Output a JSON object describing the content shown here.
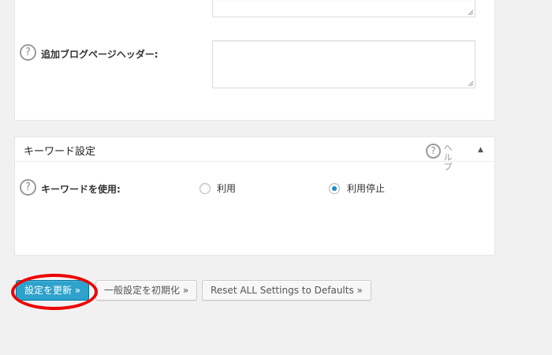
{
  "fields": {
    "extra_blog_header_label": "追加ブログページヘッダー:",
    "extra_blog_header_value": "",
    "keywords_label": "キーワードを使用:"
  },
  "keywords_box": {
    "title": "キーワード設定",
    "help_label": "ヘルプ",
    "toggle_glyph": "▲",
    "radio_options": [
      {
        "label": "利用",
        "checked": false
      },
      {
        "label": "利用停止",
        "checked": true
      }
    ]
  },
  "help_glyph": "?",
  "buttons": {
    "update": "設定を更新 »",
    "reset_general": "一般設定を初期化 »",
    "reset_all": "Reset ALL Settings to Defaults »"
  },
  "colors": {
    "primary_button": "#2ea2cc",
    "highlight": "#e00000",
    "radio_checked": "#1e8cbe"
  }
}
